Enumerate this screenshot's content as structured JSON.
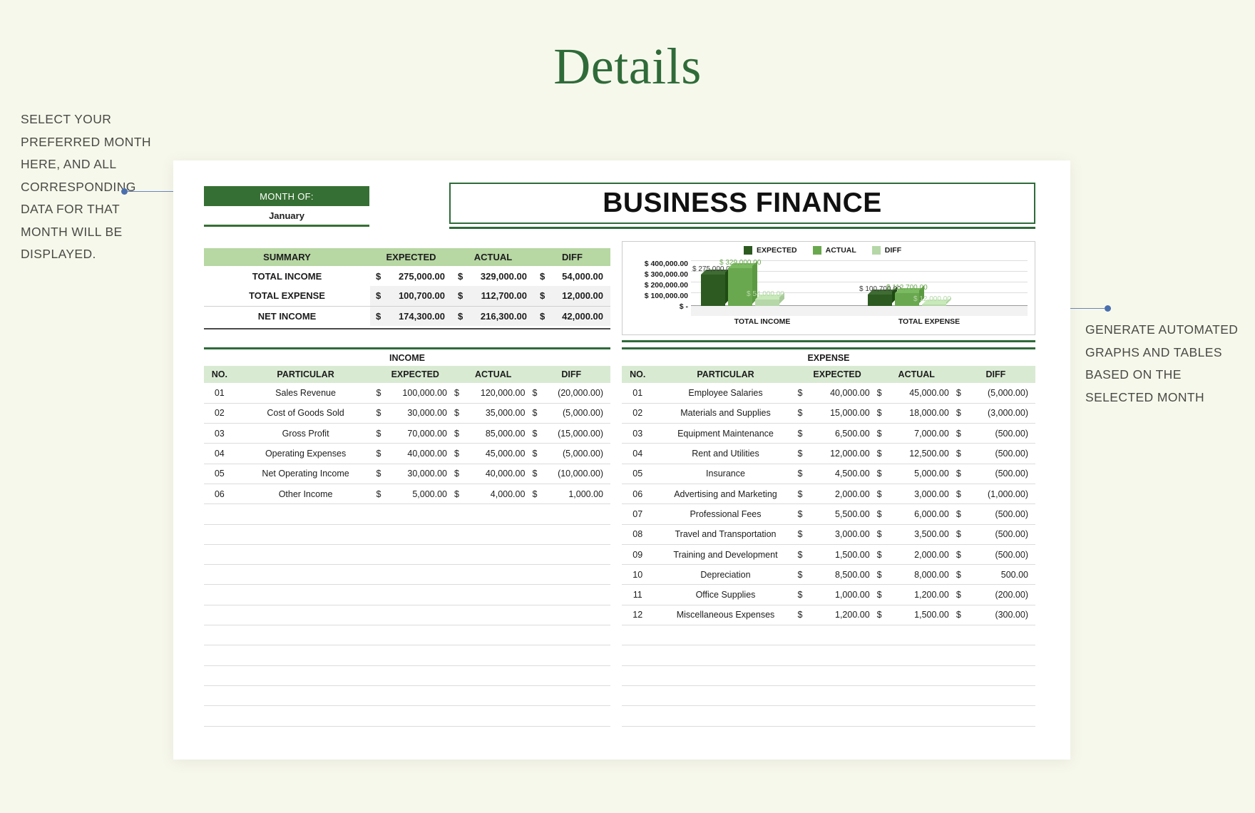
{
  "page": {
    "title": "Details"
  },
  "annotations": {
    "left": "SELECT YOUR PREFERRED MONTH HERE, AND ALL CORRESPONDING DATA FOR THAT MONTH WILL BE DISPLAYED.",
    "right": "GENERATE AUTOMATED GRAPHS AND TABLES BASED ON THE SELECTED MONTH"
  },
  "sheet": {
    "month_label": "MONTH OF:",
    "month_value": "January",
    "header_title": "BUSINESS FINANCE",
    "summary": {
      "columns": [
        "SUMMARY",
        "EXPECTED",
        "ACTUAL",
        "DIFF"
      ],
      "currency": "$",
      "rows": [
        {
          "label": "TOTAL INCOME",
          "expected": "275,000.00",
          "actual": "329,000.00",
          "diff": "54,000.00"
        },
        {
          "label": "TOTAL EXPENSE",
          "expected": "100,700.00",
          "actual": "112,700.00",
          "diff": "12,000.00"
        },
        {
          "label": "NET INCOME",
          "expected": "174,300.00",
          "actual": "216,300.00",
          "diff": "42,000.00"
        }
      ]
    },
    "income": {
      "title": "INCOME",
      "columns": [
        "NO.",
        "PARTICULAR",
        "EXPECTED",
        "ACTUAL",
        "DIFF"
      ],
      "currency": "$",
      "rows": [
        {
          "no": "01",
          "particular": "Sales Revenue",
          "expected": "100,000.00",
          "actual": "120,000.00",
          "diff": "(20,000.00)"
        },
        {
          "no": "02",
          "particular": "Cost of Goods Sold",
          "expected": "30,000.00",
          "actual": "35,000.00",
          "diff": "(5,000.00)"
        },
        {
          "no": "03",
          "particular": "Gross Profit",
          "expected": "70,000.00",
          "actual": "85,000.00",
          "diff": "(15,000.00)"
        },
        {
          "no": "04",
          "particular": "Operating Expenses",
          "expected": "40,000.00",
          "actual": "45,000.00",
          "diff": "(5,000.00)"
        },
        {
          "no": "05",
          "particular": "Net Operating Income",
          "expected": "30,000.00",
          "actual": "40,000.00",
          "diff": "(10,000.00)"
        },
        {
          "no": "06",
          "particular": "Other Income",
          "expected": "5,000.00",
          "actual": "4,000.00",
          "diff": "1,000.00"
        }
      ],
      "blank_rows": 11
    },
    "expense": {
      "title": "EXPENSE",
      "columns": [
        "NO.",
        "PARTICULAR",
        "EXPECTED",
        "ACTUAL",
        "DIFF"
      ],
      "currency": "$",
      "rows": [
        {
          "no": "01",
          "particular": "Employee Salaries",
          "expected": "40,000.00",
          "actual": "45,000.00",
          "diff": "(5,000.00)"
        },
        {
          "no": "02",
          "particular": "Materials and Supplies",
          "expected": "15,000.00",
          "actual": "18,000.00",
          "diff": "(3,000.00)"
        },
        {
          "no": "03",
          "particular": "Equipment Maintenance",
          "expected": "6,500.00",
          "actual": "7,000.00",
          "diff": "(500.00)"
        },
        {
          "no": "04",
          "particular": "Rent and Utilities",
          "expected": "12,000.00",
          "actual": "12,500.00",
          "diff": "(500.00)"
        },
        {
          "no": "05",
          "particular": "Insurance",
          "expected": "4,500.00",
          "actual": "5,000.00",
          "diff": "(500.00)"
        },
        {
          "no": "06",
          "particular": "Advertising and Marketing",
          "expected": "2,000.00",
          "actual": "3,000.00",
          "diff": "(1,000.00)"
        },
        {
          "no": "07",
          "particular": "Professional Fees",
          "expected": "5,500.00",
          "actual": "6,000.00",
          "diff": "(500.00)"
        },
        {
          "no": "08",
          "particular": "Travel and Transportation",
          "expected": "3,000.00",
          "actual": "3,500.00",
          "diff": "(500.00)"
        },
        {
          "no": "09",
          "particular": "Training and Development",
          "expected": "1,500.00",
          "actual": "2,000.00",
          "diff": "(500.00)"
        },
        {
          "no": "10",
          "particular": "Depreciation",
          "expected": "8,500.00",
          "actual": "8,000.00",
          "diff": "500.00"
        },
        {
          "no": "11",
          "particular": "Office Supplies",
          "expected": "1,000.00",
          "actual": "1,200.00",
          "diff": "(200.00)"
        },
        {
          "no": "12",
          "particular": "Miscellaneous Expenses",
          "expected": "1,200.00",
          "actual": "1,500.00",
          "diff": "(300.00)"
        }
      ],
      "blank_rows": 5
    }
  },
  "colors": {
    "expected": "#2d5a21",
    "actual": "#6aa84f",
    "diff": "#b6d7a8",
    "brand_green": "#2f6b39",
    "header_green": "#366f33",
    "summary_header": "#b7d7a3",
    "table_header": "#d9ead3"
  },
  "chart_data": {
    "type": "bar",
    "title": "",
    "categories": [
      "TOTAL INCOME",
      "TOTAL EXPENSE"
    ],
    "series": [
      {
        "name": "EXPECTED",
        "values": [
          275000,
          100700
        ],
        "color": "#2d5a21"
      },
      {
        "name": "ACTUAL",
        "values": [
          329000,
          112700
        ],
        "color": "#6aa84f"
      },
      {
        "name": "DIFF",
        "values": [
          54000,
          12000
        ],
        "color": "#b6d7a8"
      }
    ],
    "data_labels": [
      [
        "$ 275,000.00",
        "$ 329,000.00",
        "$ 54,000.00"
      ],
      [
        "$ 100,700.00",
        "$ 112,700.00",
        "$ 12,000.00"
      ]
    ],
    "ytick_labels": [
      "$ 400,000.00",
      "$ 300,000.00",
      "$ 200,000.00",
      "$ 100,000.00",
      "$ -"
    ],
    "ylim": [
      0,
      400000
    ],
    "xlabel": "",
    "ylabel": "",
    "grid": true,
    "legend": [
      "EXPECTED",
      "ACTUAL",
      "DIFF"
    ],
    "legend_position": "top-right"
  }
}
